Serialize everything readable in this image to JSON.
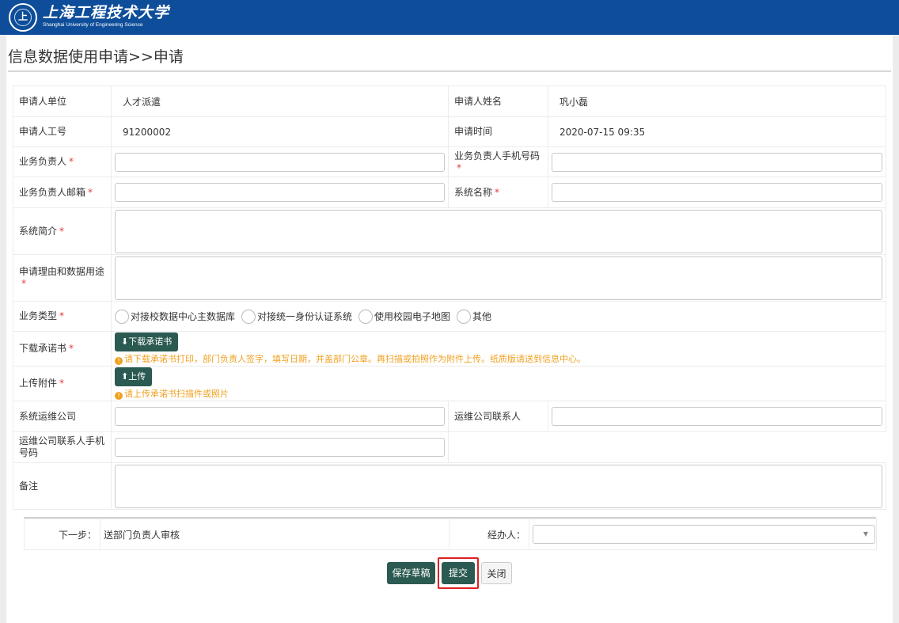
{
  "header": {
    "logo_icon": "university-seal-icon",
    "logo_cn": "上海工程技术大学",
    "logo_en": "Shanghai University of Engineering Science"
  },
  "page_title": "信息数据使用申请>>申请",
  "form": {
    "applicant_unit_label": "申请人单位",
    "applicant_unit_value": "人才派遣",
    "applicant_name_label": "申请人姓名",
    "applicant_name_value": "巩小磊",
    "applicant_id_label": "申请人工号",
    "applicant_id_value": "91200002",
    "apply_time_label": "申请时间",
    "apply_time_value": "2020-07-15 09:35",
    "biz_owner_label": "业务负责人",
    "biz_owner_phone_label": "业务负责人手机号码",
    "biz_owner_email_label": "业务负责人邮箱",
    "system_name_label": "系统名称",
    "system_intro_label": "系统简介",
    "reason_label": "申请理由和数据用途",
    "biz_type_label": "业务类型",
    "biz_type_options": [
      "对接校数据中心主数据库",
      "对接统一身份认证系统",
      "使用校园电子地图",
      "其他"
    ],
    "download_label": "下载承诺书",
    "download_button": "下载承诺书",
    "download_hint": "请下载承诺书打印，部门负责人签字，填写日期，并盖部门公章。再扫描或拍照作为附件上传。纸质版请送到信息中心。",
    "upload_label": "上传附件",
    "upload_button": "上传",
    "upload_hint": "请上传承诺书扫描件或照片",
    "ops_company_label": "系统运维公司",
    "ops_contact_label": "运维公司联系人",
    "ops_contact_phone_label": "运维公司联系人手机号码",
    "remark_label": "备注",
    "required_mark": "*"
  },
  "workflow": {
    "next_step_label": "下一步：",
    "next_step_value": "送部门负责人审核",
    "handler_label": "经办人：",
    "handler_value": ""
  },
  "actions": {
    "save_draft": "保存草稿",
    "submit": "提交",
    "close": "关闭"
  },
  "colors": {
    "header_bg": "#0e4d99",
    "button_dark": "#2b5a52",
    "required": "#e23b3b",
    "hint": "#f0a020",
    "highlight": "#e02020"
  }
}
